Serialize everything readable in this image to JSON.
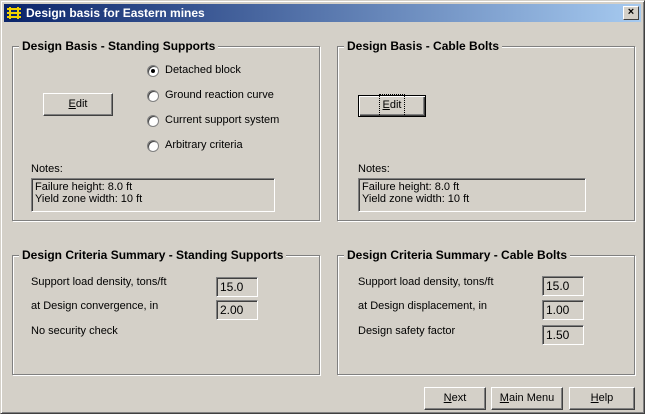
{
  "window": {
    "title": "Design basis for Eastern mines",
    "close_label": "×"
  },
  "standing_supports": {
    "group_title": "Design Basis - Standing Supports",
    "edit_label_u": "E",
    "edit_label_rest": "dit",
    "options": [
      {
        "label": "Detached block",
        "selected": true
      },
      {
        "label": "Ground reaction curve",
        "selected": false
      },
      {
        "label": "Current support system",
        "selected": false
      },
      {
        "label": "Arbitrary criteria",
        "selected": false
      }
    ],
    "notes_label": "Notes:",
    "notes_line1": "Failure height: 8.0 ft",
    "notes_line2": "Yield zone width: 10 ft"
  },
  "cable_bolts": {
    "group_title": "Design Basis - Cable Bolts",
    "edit_label_u": "E",
    "edit_label_rest": "dit",
    "notes_label": "Notes:",
    "notes_line1": "Failure height: 8.0 ft",
    "notes_line2": "Yield zone width: 10 ft"
  },
  "summary_standing": {
    "group_title": "Design Criteria Summary - Standing Supports",
    "load_density_label": "Support load density, tons/ft",
    "load_density_value": "15.0",
    "convergence_label": "at Design convergence, in",
    "convergence_value": "2.00",
    "security_text": "No security check"
  },
  "summary_cable": {
    "group_title": "Design Criteria Summary - Cable Bolts",
    "load_density_label": "Support load density, tons/ft",
    "load_density_value": "15.0",
    "displacement_label": "at Design displacement, in",
    "displacement_value": "1.00",
    "safety_label": "Design safety factor",
    "safety_value": "1.50"
  },
  "footer": {
    "next_u": "N",
    "next_rest": "ext",
    "main_menu_u": "M",
    "main_menu_rest": "ain Menu",
    "help_u": "H",
    "help_rest": "elp"
  }
}
